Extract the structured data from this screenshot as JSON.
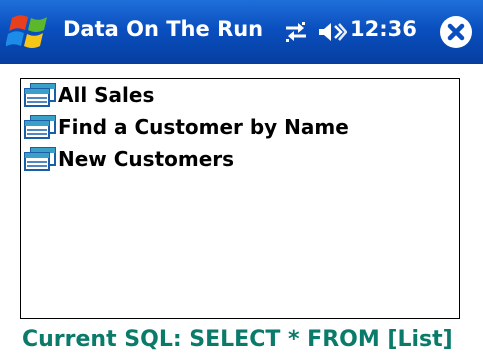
{
  "titlebar": {
    "start_icon": "windows-flag-icon",
    "title": "Data On The Run",
    "connectivity_icon": "connectivity-icon",
    "volume_icon": "speaker-icon",
    "clock": "12:36",
    "close_icon": "close-icon",
    "background_color": "#0a4fbf"
  },
  "list": {
    "items": [
      {
        "label": "All Sales",
        "icon": "table-icon"
      },
      {
        "label": "Find a Customer by Name",
        "icon": "table-icon"
      },
      {
        "label": "New Customers",
        "icon": "table-icon"
      }
    ]
  },
  "status": {
    "text": "Current SQL: SELECT * FROM [List]",
    "color": "#0a7a6a"
  }
}
